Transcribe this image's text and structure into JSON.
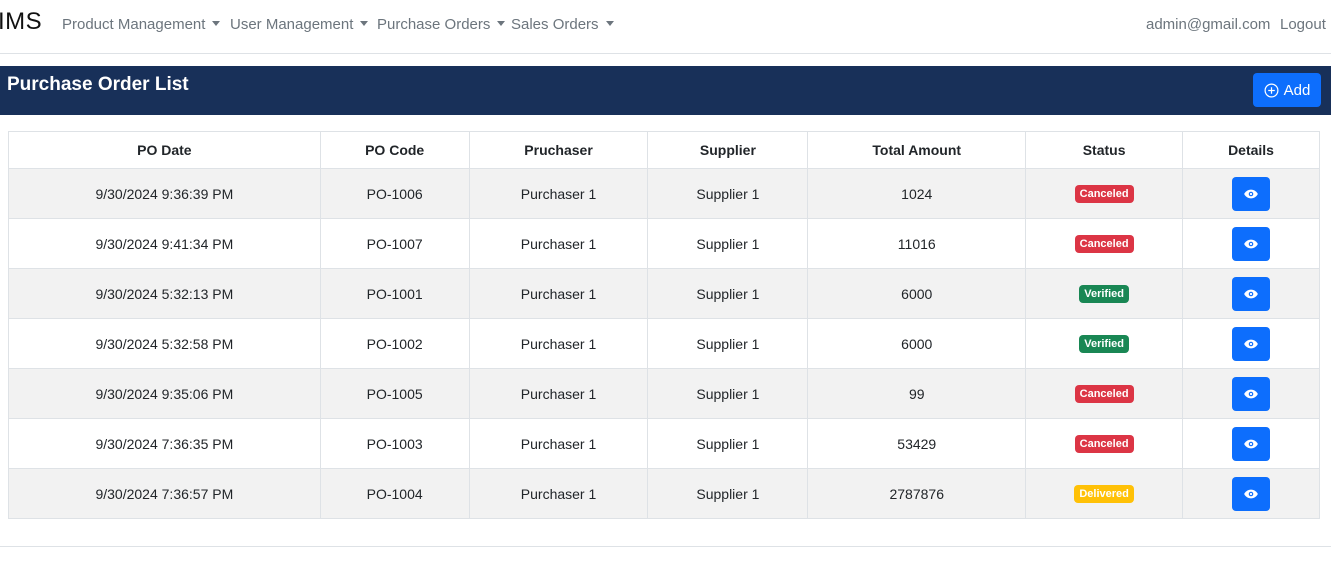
{
  "navbar": {
    "brand": "IMS",
    "menus": [
      {
        "label": "Product Management"
      },
      {
        "label": "User Management"
      },
      {
        "label": "Purchase Orders"
      },
      {
        "label": "Sales Orders"
      }
    ],
    "user_email": "admin@gmail.com",
    "logout_label": "Logout"
  },
  "header": {
    "title": "Purchase Order List",
    "add_label": "Add"
  },
  "table": {
    "columns": [
      "PO Date",
      "PO Code",
      "Pruchaser",
      "Supplier",
      "Total Amount",
      "Status",
      "Details"
    ],
    "rows": [
      {
        "date": "9/30/2024 9:36:39 PM",
        "code": "PO-1006",
        "purchaser": "Purchaser 1",
        "supplier": "Supplier 1",
        "amount": "1024",
        "status": "Canceled"
      },
      {
        "date": "9/30/2024 9:41:34 PM",
        "code": "PO-1007",
        "purchaser": "Purchaser 1",
        "supplier": "Supplier 1",
        "amount": "11016",
        "status": "Canceled"
      },
      {
        "date": "9/30/2024 5:32:13 PM",
        "code": "PO-1001",
        "purchaser": "Purchaser 1",
        "supplier": "Supplier 1",
        "amount": "6000",
        "status": "Verified"
      },
      {
        "date": "9/30/2024 5:32:58 PM",
        "code": "PO-1002",
        "purchaser": "Purchaser 1",
        "supplier": "Supplier 1",
        "amount": "6000",
        "status": "Verified"
      },
      {
        "date": "9/30/2024 9:35:06 PM",
        "code": "PO-1005",
        "purchaser": "Purchaser 1",
        "supplier": "Supplier 1",
        "amount": "99",
        "status": "Canceled"
      },
      {
        "date": "9/30/2024 7:36:35 PM",
        "code": "PO-1003",
        "purchaser": "Purchaser 1",
        "supplier": "Supplier 1",
        "amount": "53429",
        "status": "Canceled"
      },
      {
        "date": "9/30/2024 7:36:57 PM",
        "code": "PO-1004",
        "purchaser": "Purchaser 1",
        "supplier": "Supplier 1",
        "amount": "2787876",
        "status": "Delivered"
      }
    ]
  },
  "colors": {
    "header_bg": "#183059",
    "primary": "#0d6efd",
    "canceled": "#dc3545",
    "verified": "#198754",
    "delivered": "#ffc107"
  },
  "icons": {
    "add": "plus-circle-icon",
    "details": "eye-icon",
    "menu_caret": "caret-down-icon"
  }
}
